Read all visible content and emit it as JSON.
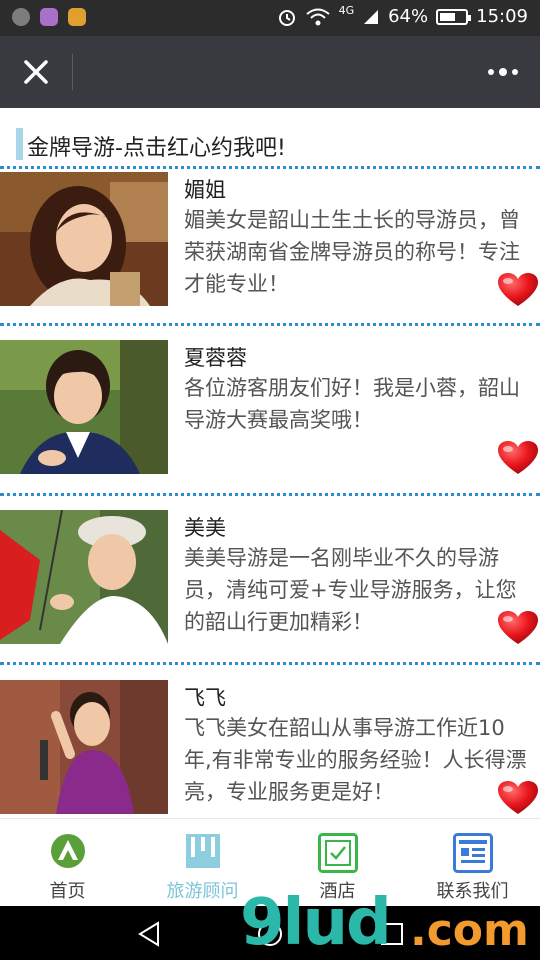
{
  "status_bar": {
    "network": "4G",
    "battery_text": "64%",
    "battery_level": 0.64,
    "time": "15:09"
  },
  "title_bar": {
    "close_icon": "close-icon",
    "more_icon": "more-icon"
  },
  "section": {
    "title": "金牌导游-点击红心约我吧!"
  },
  "guides": [
    {
      "name": "媚姐",
      "description": "媚美女是韶山土生土长的导游员，曾荣获湖南省金牌导游员的称号！专注才能专业！"
    },
    {
      "name": "夏蓉蓉",
      "description": "各位游客朋友们好！我是小蓉，韶山导游大赛最高奖哦！"
    },
    {
      "name": "美美",
      "description": "美美导游是一名刚毕业不久的导游员，清纯可爱+专业导游服务，让您的韶山行更加精彩！"
    },
    {
      "name": "飞飞",
      "description": "飞飞美女在韶山从事导游工作近10年,有非常专业的服务经验！人长得漂亮，专业服务更是好！"
    }
  ],
  "bottom_nav": [
    {
      "label": "首页",
      "icon": "home-icon"
    },
    {
      "label": "旅游顾问",
      "icon": "book-icon"
    },
    {
      "label": "酒店",
      "icon": "check-box-icon"
    },
    {
      "label": "联系我们",
      "icon": "contact-card-icon"
    }
  ],
  "colors": {
    "titlebar": "#393a3f",
    "accent_dotted": "#2b8cd0",
    "heart": "#e8161c",
    "active_nav": "#7cc4d8"
  },
  "watermark": {
    "text_a": "9lud",
    "text_b": ".com"
  }
}
